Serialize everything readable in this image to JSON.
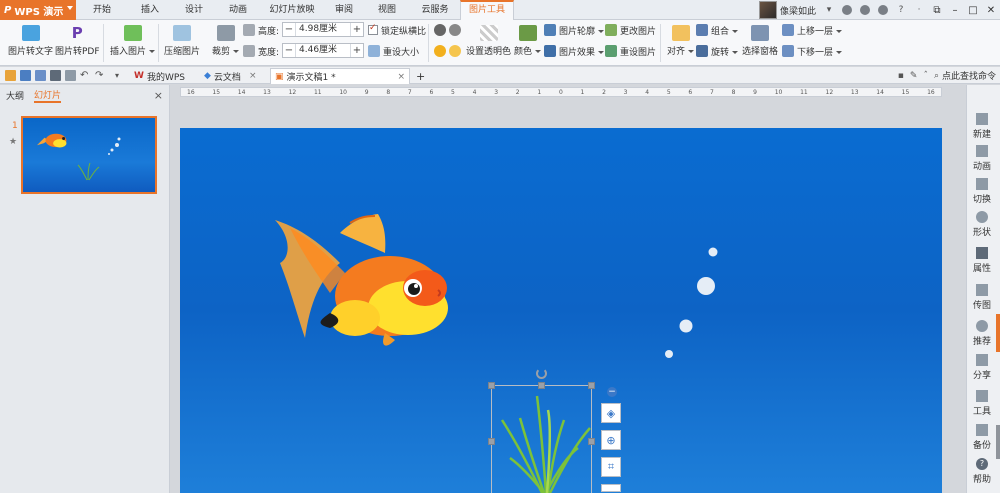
{
  "app": {
    "title": "WPS 演示",
    "logo": "P"
  },
  "menu_tabs": [
    {
      "label": "开始"
    },
    {
      "label": "插入"
    },
    {
      "label": "设计"
    },
    {
      "label": "动画"
    },
    {
      "label": "幻灯片放映"
    },
    {
      "label": "审阅"
    },
    {
      "label": "视图"
    },
    {
      "label": "云服务"
    },
    {
      "label": "图片工具",
      "active": true
    }
  ],
  "user": {
    "name": "像梁如此",
    "icon": "user-avatar"
  },
  "ribbon": {
    "pic_to_text": "图片转文字",
    "pic_to_pdf": "图片转PDF",
    "insert_picture": "插入图片",
    "compress_picture": "压缩图片",
    "crop": "裁剪",
    "height_label": "高度:",
    "height_value": "4.98厘米",
    "width_label": "宽度:",
    "width_value": "4.46厘米",
    "lock_ratio": "锁定纵横比",
    "reset_size": "重设大小",
    "set_transparent": "设置透明色",
    "color": "颜色",
    "picture_outline": "图片轮廓",
    "picture_effect": "图片效果",
    "change_picture": "更改图片",
    "reset_picture": "重设图片",
    "align": "对齐",
    "group": "组合",
    "rotate": "旋转",
    "selection_pane": "选择窗格",
    "bring_forward": "上移一层",
    "send_backward": "下移一层"
  },
  "doc_tabs": {
    "my_wps": "我的WPS",
    "cloud_docs": "云文档",
    "active_doc": "演示文稿1 *",
    "add": "+",
    "search_cmd": "点此查找命令"
  },
  "left_panel": {
    "tab_outline": "大纲",
    "tab_slides": "幻灯片",
    "close": "×",
    "slide_number": "1",
    "slide_star": "★"
  },
  "ruler": {
    "ticks": [
      "16",
      "15",
      "14",
      "13",
      "12",
      "11",
      "10",
      "9",
      "8",
      "7",
      "6",
      "5",
      "4",
      "3",
      "2",
      "1",
      "0",
      "1",
      "2",
      "3",
      "4",
      "5",
      "6",
      "7",
      "8",
      "9",
      "10",
      "11",
      "12",
      "13",
      "14",
      "15",
      "16"
    ]
  },
  "sidebar": [
    {
      "label": "新建",
      "icon": "new-icon"
    },
    {
      "label": "动画",
      "icon": "animation-icon"
    },
    {
      "label": "切换",
      "icon": "transition-icon"
    },
    {
      "label": "形状",
      "icon": "shape-icon"
    },
    {
      "label": "属性",
      "icon": "property-icon"
    },
    {
      "label": "传图",
      "icon": "upload-picture-icon"
    },
    {
      "label": "推荐",
      "icon": "recommend-icon"
    },
    {
      "label": "分享",
      "icon": "share-icon"
    },
    {
      "label": "工具",
      "icon": "tools-icon"
    },
    {
      "label": "备份",
      "icon": "backup-icon"
    },
    {
      "label": "帮助",
      "icon": "help-icon"
    }
  ],
  "colors": {
    "accent": "#e8742a",
    "slide_blue": "#0a6cd1"
  }
}
